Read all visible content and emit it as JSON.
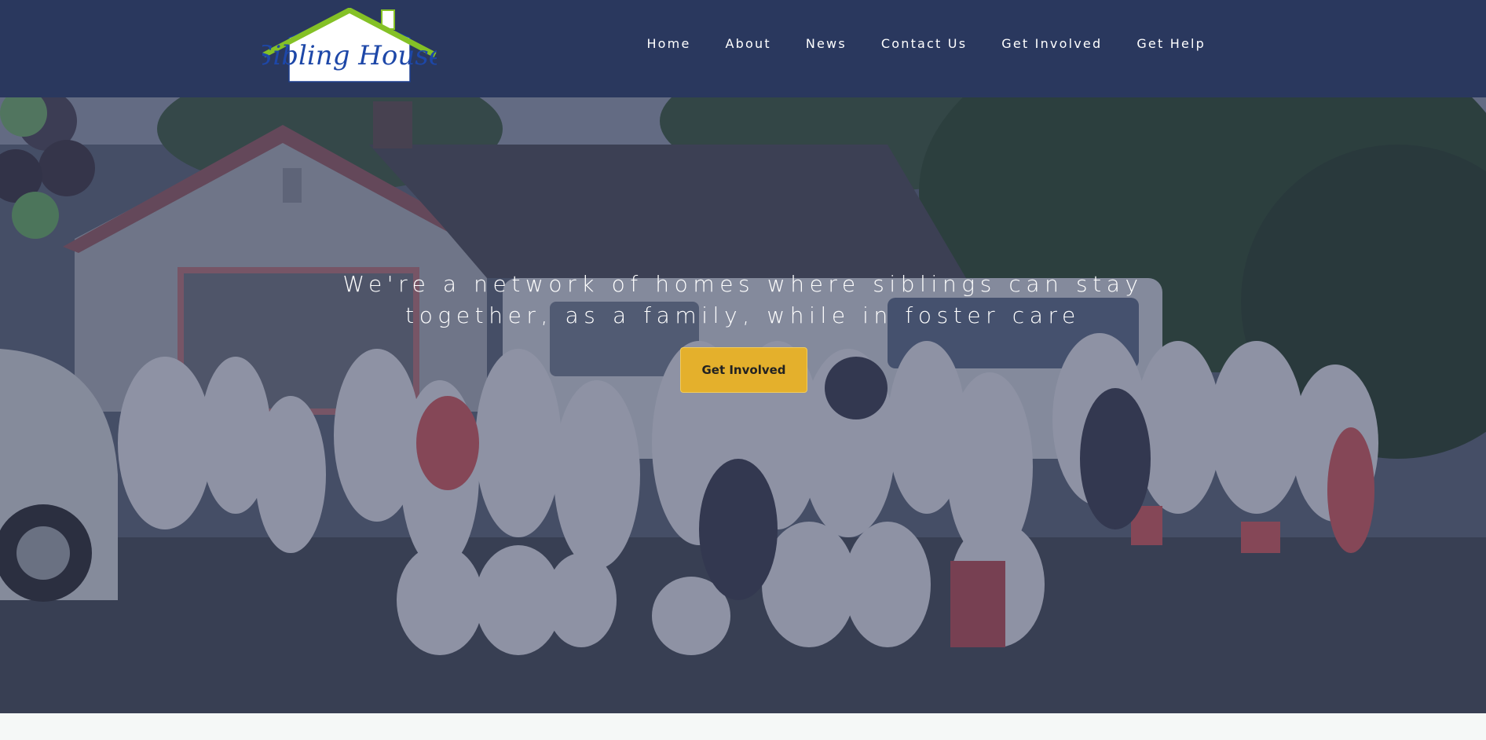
{
  "brand": {
    "logo_text": "Sibling House",
    "colors": {
      "header_bg": "#2a385e",
      "roof_green": "#84c126",
      "logo_blue": "#1d47a8",
      "cta_bg": "#e4b02c"
    }
  },
  "nav": {
    "items": [
      {
        "label": "Home"
      },
      {
        "label": "About"
      },
      {
        "label": "News"
      },
      {
        "label": "Contact Us"
      },
      {
        "label": "Get Involved"
      },
      {
        "label": "Get Help"
      }
    ]
  },
  "hero": {
    "tagline": "We're a network of homes where siblings can stay together, as a family, while in foster care",
    "cta_label": "Get Involved",
    "image": "group-photo-family-parade"
  }
}
